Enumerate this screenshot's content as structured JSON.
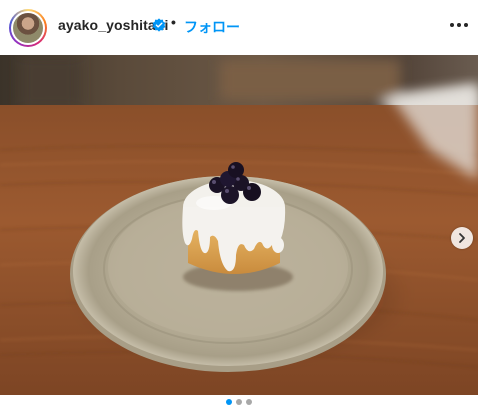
{
  "post": {
    "username": "ayako_yoshitani",
    "separator": "•",
    "follow_label": "フォロー",
    "verified_icon": "verified-badge-icon",
    "more_icon": "more-options-icon"
  },
  "carousel": {
    "next_icon": "chevron-right-icon",
    "current_slide": 1,
    "total_slides": 3,
    "accent_color": "#0095f6"
  }
}
